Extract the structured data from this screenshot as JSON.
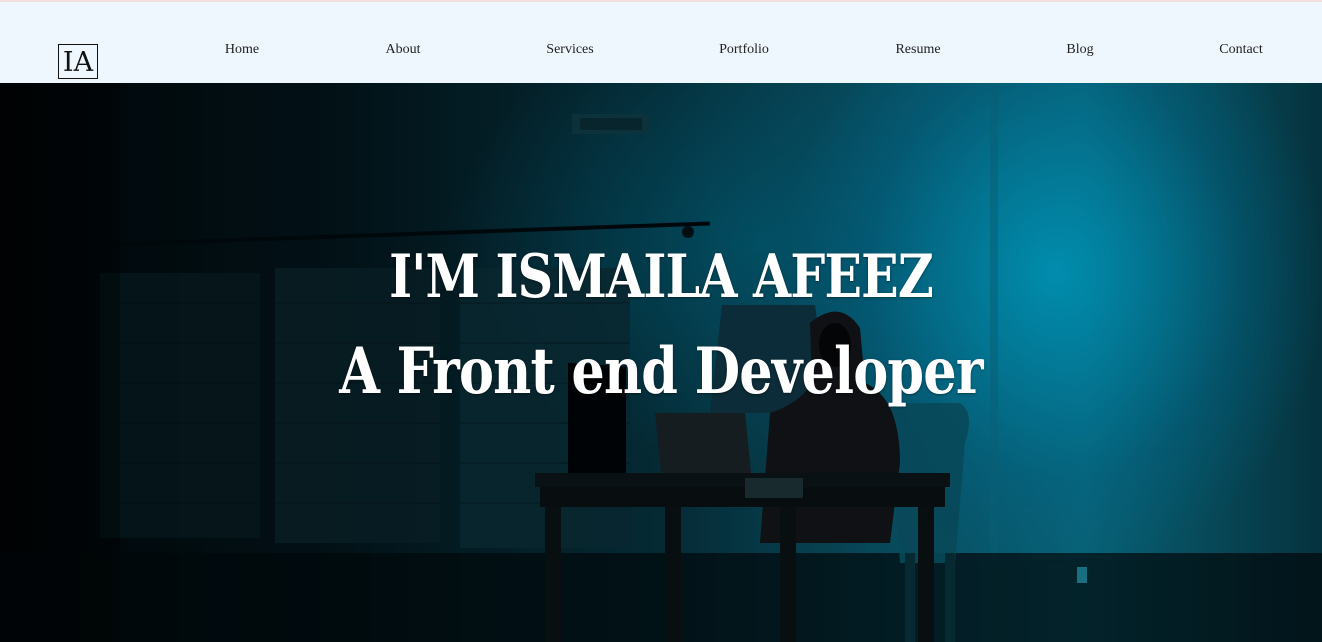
{
  "logo": {
    "text": "IA"
  },
  "nav": {
    "items": [
      {
        "label": "Home"
      },
      {
        "label": "About"
      },
      {
        "label": "Services"
      },
      {
        "label": "Portfolio"
      },
      {
        "label": "Resume"
      },
      {
        "label": "Blog"
      },
      {
        "label": "Contact"
      }
    ]
  },
  "hero": {
    "title": "I'M ISMAILA AFEEZ",
    "subtitle": "A Front end Developer",
    "background_colors": {
      "dark": "#010608",
      "teal": "#0a6f86",
      "glow": "#00aad2"
    }
  }
}
